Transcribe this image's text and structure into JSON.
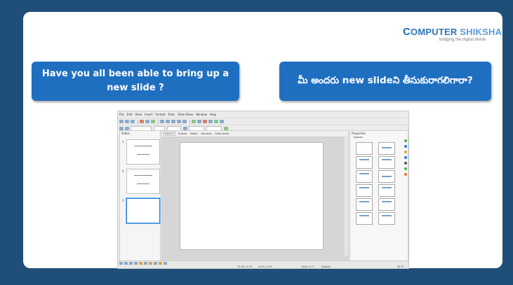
{
  "logo": {
    "brand_first": "C",
    "brand_rest": "OMPUTER ",
    "brand_second": "SHIKSHA",
    "tagline": "bridging the digital divide"
  },
  "bubbles": {
    "left_text": "Have you all been able to bring up a new slide ?",
    "right_text": "మీ అందరు new slideని తీసుకురాగలిగారా?"
  },
  "app": {
    "menu": [
      "File",
      "Edit",
      "View",
      "Insert",
      "Format",
      "Tools",
      "Slide Show",
      "Window",
      "Help"
    ],
    "slides_pane_title": "Slides",
    "view_tabs": [
      "Normal",
      "Outline",
      "Notes",
      "Handout",
      "Slide Sorter"
    ],
    "properties_title": "Properties",
    "layouts_label": "Layouts",
    "thumbnails": [
      "1",
      "2",
      "3"
    ],
    "status": {
      "position": "13.45 / 9.79",
      "size": "0.00 x 0.00",
      "slide": "Slide 3 / 3",
      "master": "Default",
      "zoom": "62 %"
    }
  }
}
